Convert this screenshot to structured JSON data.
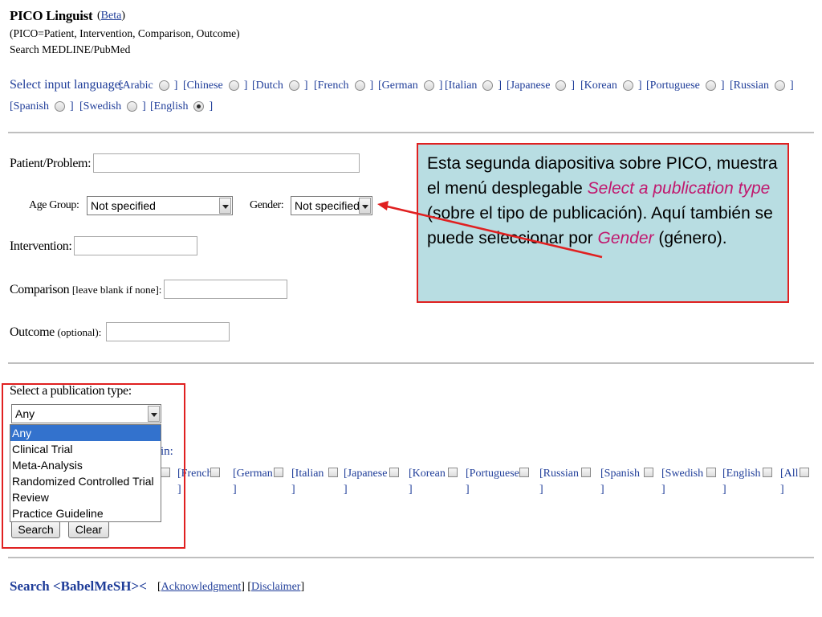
{
  "header": {
    "title": "PICO Linguist",
    "beta_open": "(",
    "beta_label": "Beta",
    "beta_close": ")",
    "subtitle_1": "(PICO=Patient, Intervention, Comparison, Outcome)",
    "subtitle_2": "Search MEDLINE/PubMed"
  },
  "input_language": {
    "label": "Select input language:",
    "row1": [
      "[Arabic",
      "[Chinese",
      "[Dutch",
      "[French",
      "[German",
      "[Italian",
      "[Japanese",
      "[Korean",
      "[Portuguese",
      "[Russian"
    ],
    "row2": [
      "[Spanish",
      "[Swedish",
      "[English"
    ],
    "selected": "[English",
    "close": "]"
  },
  "form": {
    "patient_label": "Patient/Problem:",
    "age_group_label": "Age Group:",
    "age_group_value": "Not specified",
    "gender_label": "Gender:",
    "gender_value": "Not specified",
    "intervention_label": "Intervention:",
    "comparison_label": "Comparison",
    "comparison_note": "[leave blank if none]:",
    "outcome_label": "Outcome",
    "outcome_note": "(optional):"
  },
  "publication": {
    "label": "Select a publication type:",
    "value": "Any",
    "options": [
      "Any",
      "Clinical Trial",
      "Meta-Analysis",
      "Randomized Controlled Trial",
      "Review",
      "Practice Guideline"
    ],
    "hidden_label_fragment": "in:"
  },
  "output_language": {
    "items": [
      "[French",
      "[German",
      "[Italian",
      "[Japanese",
      "[Korean",
      "[Portuguese",
      "[Russian",
      "[Spanish",
      "[Swedish",
      "[English",
      "[All"
    ],
    "close": "]"
  },
  "buttons": {
    "search": "Search",
    "clear": "Clear"
  },
  "footer": {
    "search_label": "Search <BabelMeSH><",
    "acknowledgment": "Acknowledgment",
    "disclaimer": "Disclaimer"
  },
  "callout": {
    "part1": "Esta segunda diapositiva sobre PICO, muestra el menú desplegable ",
    "highlight1": "Select a publication type",
    "part2": " (sobre el tipo de publicación).  Aquí también se puede seleccionar por ",
    "highlight2": "Gender",
    "part3": " (género)."
  },
  "colors": {
    "link_blue": "#1f3d99",
    "callout_bg": "#b8dde2",
    "callout_border": "#e02020",
    "highlight": "#c0186e",
    "selected_option": "#3372cd"
  }
}
